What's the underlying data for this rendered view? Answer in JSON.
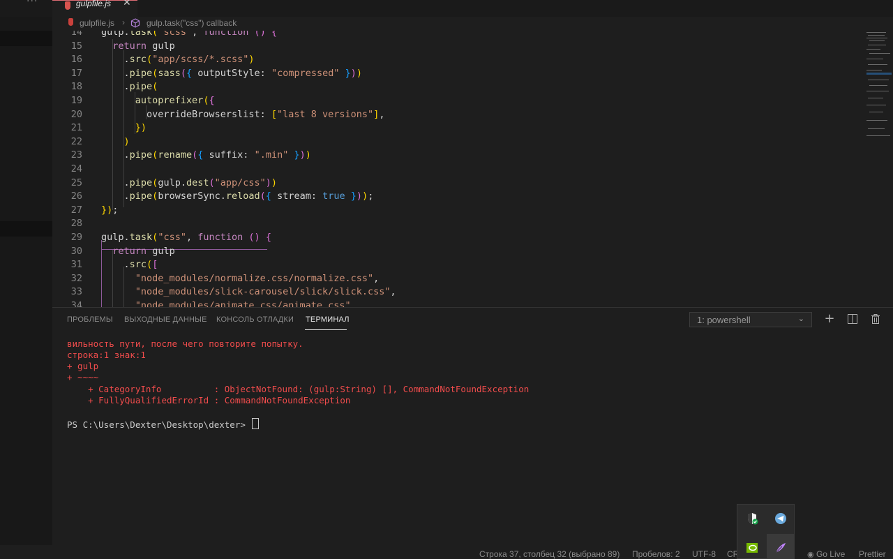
{
  "tabs": [
    {
      "label": "gulpfile.js",
      "active": true
    }
  ],
  "breadcrumb": {
    "file": "gulpfile.js",
    "symbol": "gulp.task(\"css\") callback"
  },
  "editor": {
    "lines": [
      {
        "n": "14",
        "text": "gulp.task(\"scss\", function () {"
      },
      {
        "n": "15",
        "text": "  return gulp"
      },
      {
        "n": "16",
        "text": "    .src(\"app/scss/*.scss\")"
      },
      {
        "n": "17",
        "text": "    .pipe(sass({ outputStyle: \"compressed\" }))"
      },
      {
        "n": "18",
        "text": "    .pipe("
      },
      {
        "n": "19",
        "text": "      autoprefixer({"
      },
      {
        "n": "20",
        "text": "        overrideBrowserslist: [\"last 8 versions\"],"
      },
      {
        "n": "21",
        "text": "      })"
      },
      {
        "n": "22",
        "text": "    )"
      },
      {
        "n": "23",
        "text": "    .pipe(rename({ suffix: \".min\" }))"
      },
      {
        "n": "24",
        "text": ""
      },
      {
        "n": "25",
        "text": "    .pipe(gulp.dest(\"app/css\"))"
      },
      {
        "n": "26",
        "text": "    .pipe(browserSync.reload({ stream: true }));"
      },
      {
        "n": "27",
        "text": "});"
      },
      {
        "n": "28",
        "text": ""
      },
      {
        "n": "29",
        "text": "gulp.task(\"css\", function () {"
      },
      {
        "n": "30",
        "text": "  return gulp"
      },
      {
        "n": "31",
        "text": "    .src(["
      },
      {
        "n": "32",
        "text": "      \"node_modules/normalize.css/normalize.css\","
      },
      {
        "n": "33",
        "text": "      \"node_modules/slick-carousel/slick/slick.css\","
      },
      {
        "n": "34",
        "text": "      \"node_modules/animate.css/animate.css\","
      }
    ]
  },
  "panel": {
    "tabs": [
      "ПРОБЛЕМЫ",
      "ВЫХОДНЫЕ ДАННЫЕ",
      "КОНСОЛЬ ОТЛАДКИ",
      "ТЕРМИНАЛ"
    ],
    "terminal_select": "1: powershell",
    "terminal_lines": [
      "вильность пути, после чего повторите попытку.",
      "строка:1 знак:1",
      "+ gulp",
      "+ ~~~~",
      "    + CategoryInfo          : ObjectNotFound: (gulp:String) [], CommandNotFoundException",
      "    + FullyQualifiedErrorId : CommandNotFoundException"
    ],
    "prompt": "PS C:\\Users\\Dexter\\Desktop\\dexter> "
  },
  "statusbar": {
    "position": "Строка 37, столбец 32 (выбрано 89)",
    "spaces": "Пробелов: 2",
    "encoding": "UTF-8",
    "eol": "CR",
    "golive": "Go Live",
    "prettier": "Prettier"
  },
  "colors": {
    "accent_tab": "#e06c75",
    "error": "#f14c4c",
    "keyword": "#c586c0",
    "string": "#ce9178",
    "function": "#dcdcaa"
  }
}
